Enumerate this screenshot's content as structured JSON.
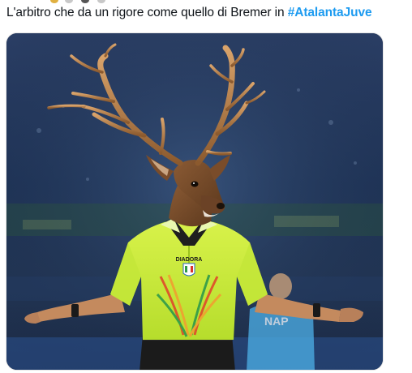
{
  "tweet": {
    "text_prefix": "L'arbitro che da un rigore come quello di Bremer in ",
    "hashtag": "#AtalantaJuve",
    "accent_color": "#1d9bf0"
  },
  "media": {
    "shirt_brand": "DIADORA",
    "crest_icon": "italy-crest-icon"
  }
}
